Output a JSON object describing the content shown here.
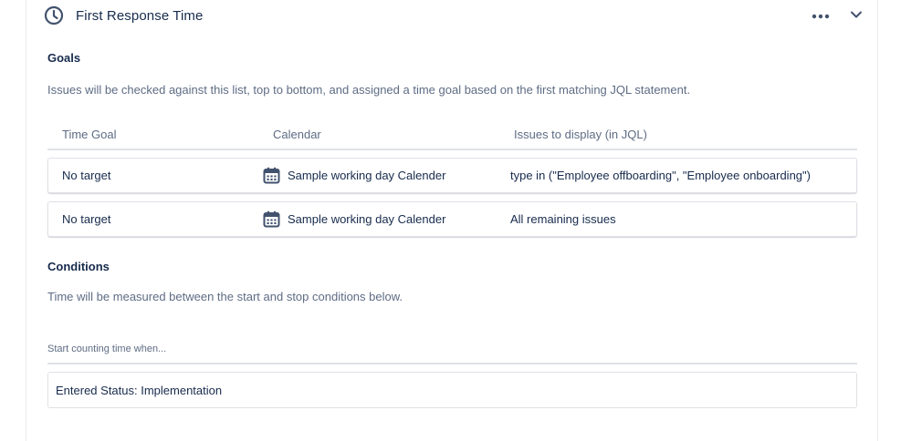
{
  "section": {
    "title": "First Response Time",
    "icons": {
      "header": "clock-icon",
      "more": "more-horizontal-icon",
      "collapse": "chevron-down-icon",
      "calendar": "calendar-icon"
    }
  },
  "goals": {
    "heading": "Goals",
    "description": "Issues will be checked against this list, top to bottom, and assigned a time goal based on the first matching JQL statement.",
    "columns": [
      "Time Goal",
      "Calendar",
      "Issues to display (in JQL)"
    ],
    "rows": [
      {
        "time_goal": "No target",
        "calendar": "Sample working day Calender",
        "jql": "type in (\"Employee offboarding\", \"Employee onboarding\")"
      },
      {
        "time_goal": "No target",
        "calendar": "Sample working day Calender",
        "jql": "All remaining issues"
      }
    ]
  },
  "conditions": {
    "heading": "Conditions",
    "description": "Time will be measured between the start and stop conditions below.",
    "start_label": "Start counting time when...",
    "start_value": "Entered Status: Implementation"
  },
  "colors": {
    "text": "#172b4d",
    "muted": "#5e6c84",
    "border": "#dfe1e6",
    "icon": "#42526e"
  }
}
